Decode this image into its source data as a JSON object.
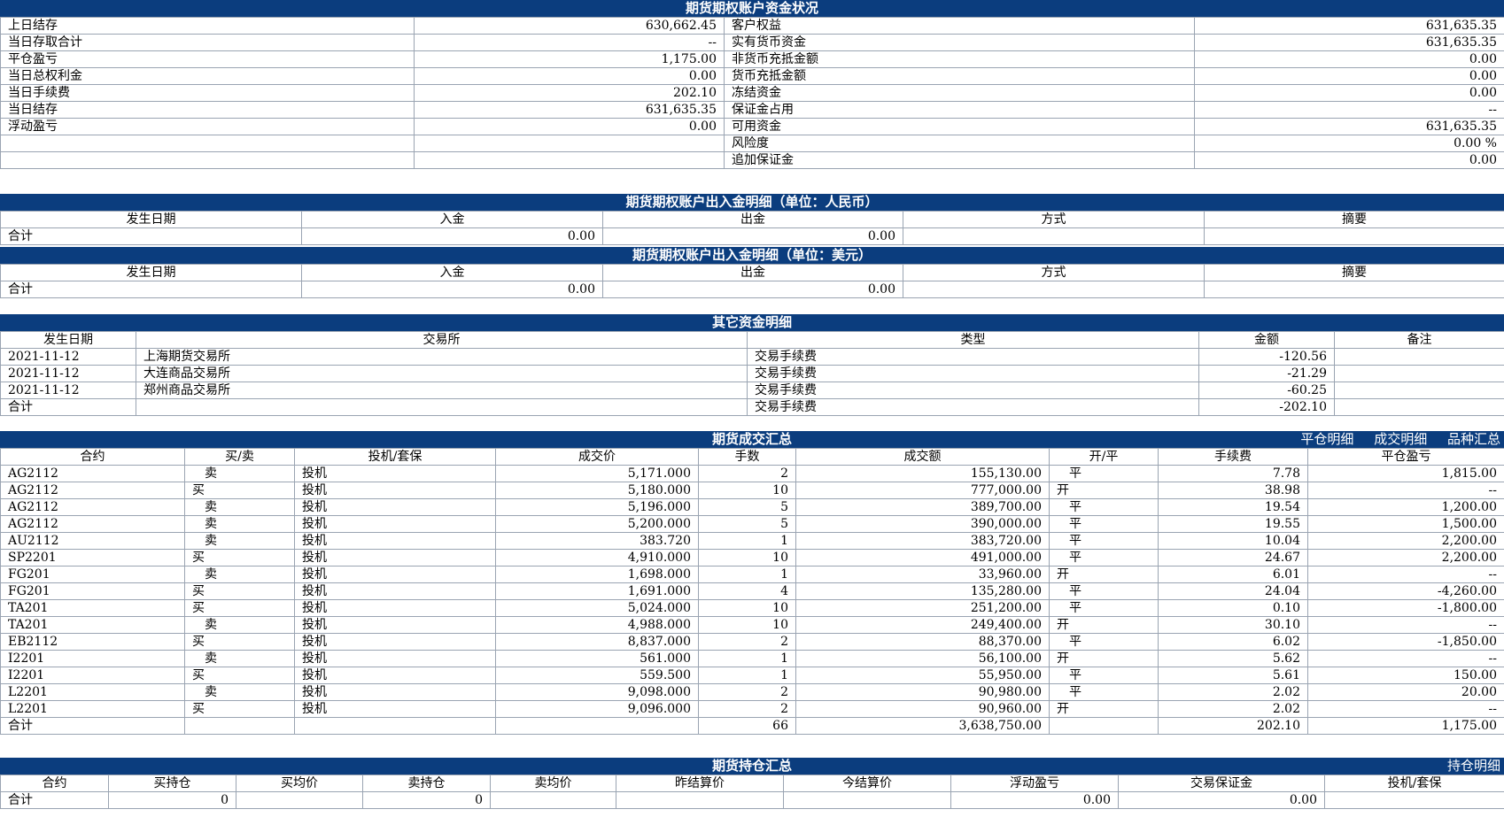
{
  "summary": {
    "title": "期货期权账户资金状况",
    "left": [
      {
        "label": "上日结存",
        "value": "630,662.45"
      },
      {
        "label": "当日存取合计",
        "value": "--"
      },
      {
        "label": "平仓盈亏",
        "value": "1,175.00"
      },
      {
        "label": "当日总权利金",
        "value": "0.00"
      },
      {
        "label": "当日手续费",
        "value": "202.10"
      },
      {
        "label": "当日结存",
        "value": "631,635.35"
      },
      {
        "label": "浮动盈亏",
        "value": "0.00"
      },
      {
        "label": "",
        "value": ""
      },
      {
        "label": "",
        "value": ""
      }
    ],
    "right": [
      {
        "label": "客户权益",
        "value": "631,635.35"
      },
      {
        "label": "实有货币资金",
        "value": "631,635.35"
      },
      {
        "label": "非货币充抵金额",
        "value": "0.00"
      },
      {
        "label": "货币充抵金额",
        "value": "0.00"
      },
      {
        "label": "冻结资金",
        "value": "0.00"
      },
      {
        "label": "保证金占用",
        "value": "--"
      },
      {
        "label": "可用资金",
        "value": "631,635.35"
      },
      {
        "label": "风险度",
        "value": "0.00 %"
      },
      {
        "label": "追加保证金",
        "value": "0.00"
      }
    ]
  },
  "cny": {
    "title": "期货期权账户出入金明细（单位：人民币）",
    "headers": [
      "发生日期",
      "入金",
      "出金",
      "方式",
      "摘要"
    ],
    "total": {
      "label": "合计",
      "in": "0.00",
      "out": "0.00"
    }
  },
  "usd": {
    "title": "期货期权账户出入金明细（单位：美元）",
    "headers": [
      "发生日期",
      "入金",
      "出金",
      "方式",
      "摘要"
    ],
    "total": {
      "label": "合计",
      "in": "0.00",
      "out": "0.00"
    }
  },
  "other": {
    "title": "其它资金明细",
    "headers": [
      "发生日期",
      "交易所",
      "类型",
      "金额",
      "备注"
    ],
    "rows": [
      {
        "date": "2021-11-12",
        "exchange": "上海期货交易所",
        "type": "交易手续费",
        "amount": "-120.56",
        "note": ""
      },
      {
        "date": "2021-11-12",
        "exchange": "大连商品交易所",
        "type": "交易手续费",
        "amount": "-21.29",
        "note": ""
      },
      {
        "date": "2021-11-12",
        "exchange": "郑州商品交易所",
        "type": "交易手续费",
        "amount": "-60.25",
        "note": ""
      }
    ],
    "total": {
      "label": "合计",
      "type": "交易手续费",
      "amount": "-202.10"
    }
  },
  "trades": {
    "title": "期货成交汇总",
    "links": [
      "平仓明细",
      "成交明细",
      "品种汇总"
    ],
    "headers": [
      "合约",
      "买/卖",
      "投机/套保",
      "成交价",
      "手数",
      "成交额",
      "开/平",
      "手续费",
      "平仓盈亏"
    ],
    "rows": [
      {
        "c": "AG2112",
        "bs": "卖",
        "h": "投机",
        "p": "5,171.000",
        "q": "2",
        "amt": "155,130.00",
        "oc": "平",
        "fee": "7.78",
        "pnl": "1,815.00"
      },
      {
        "c": "AG2112",
        "bs": "买",
        "h": "投机",
        "p": "5,180.000",
        "q": "10",
        "amt": "777,000.00",
        "oc": "开",
        "fee": "38.98",
        "pnl": "--"
      },
      {
        "c": "AG2112",
        "bs": "卖",
        "h": "投机",
        "p": "5,196.000",
        "q": "5",
        "amt": "389,700.00",
        "oc": "平",
        "fee": "19.54",
        "pnl": "1,200.00"
      },
      {
        "c": "AG2112",
        "bs": "卖",
        "h": "投机",
        "p": "5,200.000",
        "q": "5",
        "amt": "390,000.00",
        "oc": "平",
        "fee": "19.55",
        "pnl": "1,500.00"
      },
      {
        "c": "AU2112",
        "bs": "卖",
        "h": "投机",
        "p": "383.720",
        "q": "1",
        "amt": "383,720.00",
        "oc": "平",
        "fee": "10.04",
        "pnl": "2,200.00"
      },
      {
        "c": "SP2201",
        "bs": "买",
        "h": "投机",
        "p": "4,910.000",
        "q": "10",
        "amt": "491,000.00",
        "oc": "平",
        "fee": "24.67",
        "pnl": "2,200.00"
      },
      {
        "c": "FG201",
        "bs": "卖",
        "h": "投机",
        "p": "1,698.000",
        "q": "1",
        "amt": "33,960.00",
        "oc": "开",
        "fee": "6.01",
        "pnl": "--"
      },
      {
        "c": "FG201",
        "bs": "买",
        "h": "投机",
        "p": "1,691.000",
        "q": "4",
        "amt": "135,280.00",
        "oc": "平",
        "fee": "24.04",
        "pnl": "-4,260.00"
      },
      {
        "c": "TA201",
        "bs": "买",
        "h": "投机",
        "p": "5,024.000",
        "q": "10",
        "amt": "251,200.00",
        "oc": "平",
        "fee": "0.10",
        "pnl": "-1,800.00"
      },
      {
        "c": "TA201",
        "bs": "卖",
        "h": "投机",
        "p": "4,988.000",
        "q": "10",
        "amt": "249,400.00",
        "oc": "开",
        "fee": "30.10",
        "pnl": "--"
      },
      {
        "c": "EB2112",
        "bs": "买",
        "h": "投机",
        "p": "8,837.000",
        "q": "2",
        "amt": "88,370.00",
        "oc": "平",
        "fee": "6.02",
        "pnl": "-1,850.00"
      },
      {
        "c": "I2201",
        "bs": "卖",
        "h": "投机",
        "p": "561.000",
        "q": "1",
        "amt": "56,100.00",
        "oc": "开",
        "fee": "5.62",
        "pnl": "--"
      },
      {
        "c": "I2201",
        "bs": "买",
        "h": "投机",
        "p": "559.500",
        "q": "1",
        "amt": "55,950.00",
        "oc": "平",
        "fee": "5.61",
        "pnl": "150.00"
      },
      {
        "c": "L2201",
        "bs": "卖",
        "h": "投机",
        "p": "9,098.000",
        "q": "2",
        "amt": "90,980.00",
        "oc": "平",
        "fee": "2.02",
        "pnl": "20.00"
      },
      {
        "c": "L2201",
        "bs": "买",
        "h": "投机",
        "p": "9,096.000",
        "q": "2",
        "amt": "90,960.00",
        "oc": "开",
        "fee": "2.02",
        "pnl": "--"
      }
    ],
    "total": {
      "label": "合计",
      "q": "66",
      "amt": "3,638,750.00",
      "fee": "202.10",
      "pnl": "1,175.00"
    }
  },
  "positions": {
    "title": "期货持仓汇总",
    "links": [
      "持仓明细"
    ],
    "headers": [
      "合约",
      "买持仓",
      "买均价",
      "卖持仓",
      "卖均价",
      "昨结算价",
      "今结算价",
      "浮动盈亏",
      "交易保证金",
      "投机/套保"
    ],
    "total": {
      "label": "合计",
      "buy": "0",
      "sell": "0",
      "float": "0.00",
      "margin": "0.00"
    }
  }
}
